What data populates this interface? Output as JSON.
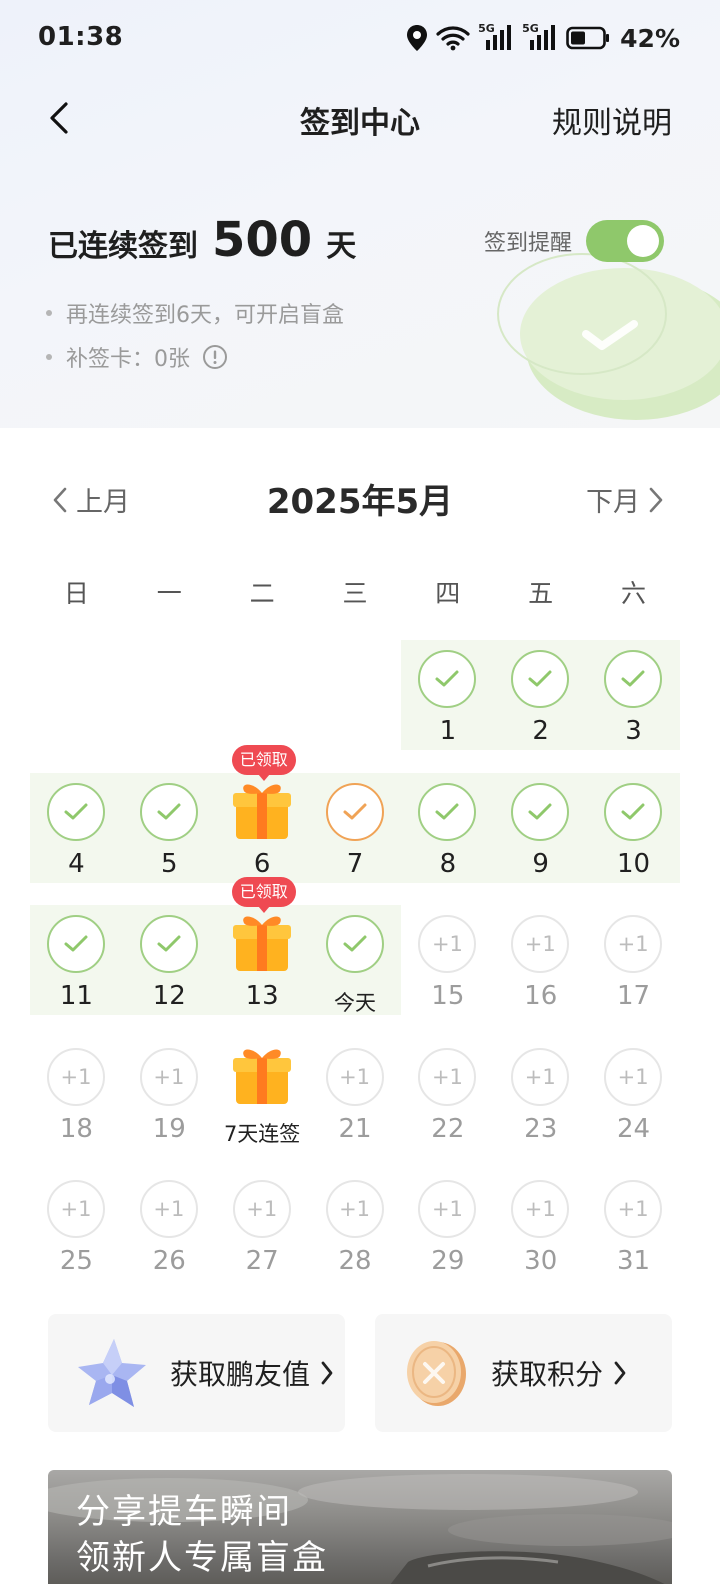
{
  "status_bar": {
    "time": "01:38",
    "battery": "42%",
    "network_1": "5G",
    "network_2": "5G"
  },
  "nav": {
    "title": "签到中心",
    "rules": "规则说明"
  },
  "streak": {
    "label": "已连续签到",
    "days": "500",
    "unit": "天"
  },
  "reminder": {
    "label": "签到提醒",
    "enabled": true
  },
  "tips": [
    "再连续签到6天，可开启盲盒",
    "补签卡：0张"
  ],
  "calendar": {
    "prev": "上月",
    "month": "2025年5月",
    "next": "下月",
    "weekdays": [
      "日",
      "一",
      "二",
      "三",
      "四",
      "五",
      "六"
    ],
    "check_mark": "✓",
    "plus_one": "+1",
    "claimed_badge": "已领取",
    "today_label": "今天",
    "bonus_label": "7天连签"
  },
  "cards": [
    {
      "label": "获取鹏友值",
      "icon": "star-icon"
    },
    {
      "label": "获取积分",
      "icon": "coin-icon"
    }
  ],
  "banner": {
    "line1": "分享提车瞬间",
    "line2": "领新人专属盲盒"
  },
  "colors": {
    "accent_green": "#8fc86b",
    "check_border": "#a0cf84",
    "today_border": "#f0a356",
    "badge_red": "#ef4a52",
    "streak_band": "#f3f8ee"
  }
}
